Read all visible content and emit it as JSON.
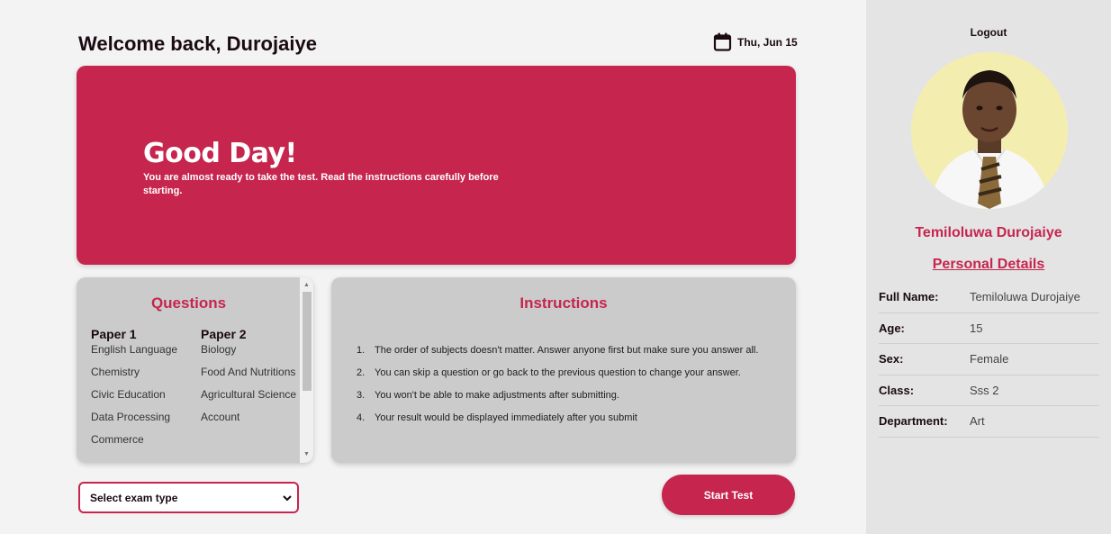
{
  "header": {
    "welcome": "Welcome back, Durojaiye",
    "date": "Thu, Jun 15"
  },
  "hero": {
    "title": "Good Day!",
    "subtitle": "You are almost ready to take the test. Read the instructions carefully before starting."
  },
  "questions": {
    "title": "Questions",
    "papers": [
      {
        "heading": "Paper 1",
        "subjects": [
          "English Language",
          "Chemistry",
          "Civic Education",
          "Data Processing",
          "Commerce"
        ]
      },
      {
        "heading": "Paper 2",
        "subjects": [
          "Biology",
          "Food And Nutritions",
          "Agricultural Science",
          "Account"
        ]
      }
    ]
  },
  "instructions": {
    "title": "Instructions",
    "items": [
      "The order of subjects doesn't matter. Answer anyone first but make sure you answer all.",
      "You can skip a question or go back to the previous question to change your answer.",
      "You won't be able to make adjustments after submitting.",
      "Your result would be displayed immediately after you submit"
    ]
  },
  "exam_select": {
    "selected": "Select exam type"
  },
  "start_button": {
    "label": "Start Test"
  },
  "sidebar": {
    "logout": "Logout",
    "student_name": "Temiloluwa Durojaiye",
    "details_title": "Personal Details",
    "details": [
      {
        "key": "Full Name:",
        "value": "Temiloluwa Durojaiye"
      },
      {
        "key": "Age:",
        "value": "15"
      },
      {
        "key": "Sex:",
        "value": "Female"
      },
      {
        "key": "Class:",
        "value": "Sss 2"
      },
      {
        "key": "Department:",
        "value": "Art"
      }
    ]
  },
  "colors": {
    "accent": "#c6254e",
    "panel": "#cbcbcb",
    "sidebar": "#e4e4e4",
    "background": "#f3f3f3"
  },
  "icons": {
    "date": "calendar-icon",
    "select": "chevron-down-icon",
    "scroll_up": "arrow-up-icon",
    "scroll_down": "arrow-down-icon"
  }
}
